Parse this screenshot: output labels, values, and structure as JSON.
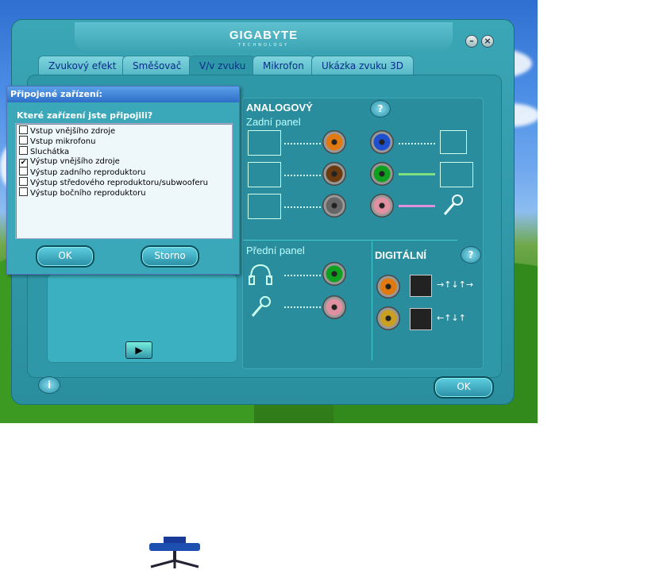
{
  "window": {
    "brand": "GIGABYTE",
    "brand_sub": "TECHNOLOGY",
    "min_label": "–",
    "close_label": "×"
  },
  "tabs": [
    {
      "label": "Zvukový efekt"
    },
    {
      "label": "Směšovač"
    },
    {
      "label": "V/v zvuku"
    },
    {
      "label": "Mikrofon"
    },
    {
      "label": "Ukázka zvuku 3D"
    }
  ],
  "active_tab": "V/v zvuku",
  "analog": {
    "title": "ANALOGOVÝ",
    "rear_label": "Zadní panel",
    "front_label": "Přední panel"
  },
  "digital": {
    "title": "DIGITÁLNÍ"
  },
  "colors": {
    "orange": "#e07a10",
    "brown": "#6a3a10",
    "gray": "#666666",
    "blue": "#1e4fd0",
    "green": "#10a020",
    "pink": "#e090a0"
  },
  "dialog": {
    "title": "Připojené zařízení:",
    "question": "Které zařízení jste připojili?",
    "items": [
      {
        "label": "Vstup vnějšího zdroje",
        "checked": false
      },
      {
        "label": "Vstup mikrofonu",
        "checked": false
      },
      {
        "label": "Sluchátka",
        "checked": false
      },
      {
        "label": "Výstup vnějšího zdroje",
        "checked": true
      },
      {
        "label": "Výstup zadního reproduktoru",
        "checked": false
      },
      {
        "label": "Výstup středového reproduktoru/subwooferu",
        "checked": false
      },
      {
        "label": "Výstup bočního reproduktoru",
        "checked": false
      }
    ],
    "ok": "OK",
    "cancel": "Storno"
  },
  "footer": {
    "ok": "OK",
    "info_icon": "i"
  },
  "icons": {
    "play": "▶",
    "help": "?",
    "check": "✔"
  }
}
